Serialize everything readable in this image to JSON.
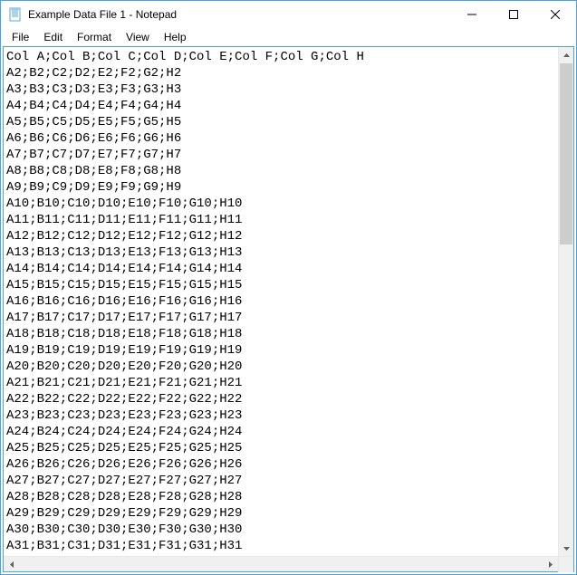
{
  "window": {
    "title": "Example Data File 1 - Notepad"
  },
  "menu": {
    "file": "File",
    "edit": "Edit",
    "format": "Format",
    "view": "View",
    "help": "Help"
  },
  "editor": {
    "content": "Col A;Col B;Col C;Col D;Col E;Col F;Col G;Col H\nA2;B2;C2;D2;E2;F2;G2;H2\nA3;B3;C3;D3;E3;F3;G3;H3\nA4;B4;C4;D4;E4;F4;G4;H4\nA5;B5;C5;D5;E5;F5;G5;H5\nA6;B6;C6;D6;E6;F6;G6;H6\nA7;B7;C7;D7;E7;F7;G7;H7\nA8;B8;C8;D8;E8;F8;G8;H8\nA9;B9;C9;D9;E9;F9;G9;H9\nA10;B10;C10;D10;E10;F10;G10;H10\nA11;B11;C11;D11;E11;F11;G11;H11\nA12;B12;C12;D12;E12;F12;G12;H12\nA13;B13;C13;D13;E13;F13;G13;H13\nA14;B14;C14;D14;E14;F14;G14;H14\nA15;B15;C15;D15;E15;F15;G15;H15\nA16;B16;C16;D16;E16;F16;G16;H16\nA17;B17;C17;D17;E17;F17;G17;H17\nA18;B18;C18;D18;E18;F18;G18;H18\nA19;B19;C19;D19;E19;F19;G19;H19\nA20;B20;C20;D20;E20;F20;G20;H20\nA21;B21;C21;D21;E21;F21;G21;H21\nA22;B22;C22;D22;E22;F22;G22;H22\nA23;B23;C23;D23;E23;F23;G23;H23\nA24;B24;C24;D24;E24;F24;G24;H24\nA25;B25;C25;D25;E25;F25;G25;H25\nA26;B26;C26;D26;E26;F26;G26;H26\nA27;B27;C27;D27;E27;F27;G27;H27\nA28;B28;C28;D28;E28;F28;G28;H28\nA29;B29;C29;D29;E29;F29;G29;H29\nA30;B30;C30;D30;E30;F30;G30;H30\nA31;B31;C31;D31;E31;F31;G31;H31"
  }
}
